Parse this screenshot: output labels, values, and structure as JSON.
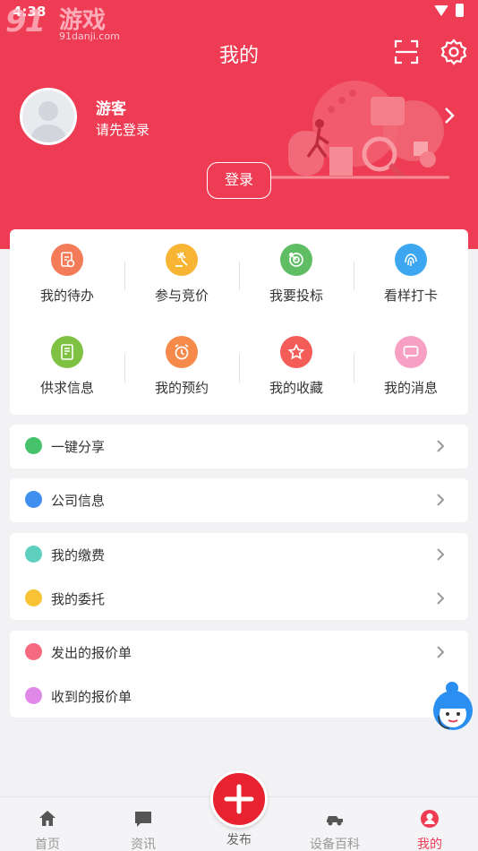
{
  "status": {
    "time": "4:38"
  },
  "watermark": {
    "logo": "91",
    "name": "游戏",
    "url": "91danji.com"
  },
  "header": {
    "title": "我的"
  },
  "profile": {
    "name": "游客",
    "hint": "请先登录",
    "login_label": "登录"
  },
  "grid": [
    {
      "label": "我的待办",
      "icon": "todo-icon",
      "color": "#f47b57"
    },
    {
      "label": "参与竞价",
      "icon": "auction-hammer-icon",
      "color": "#f7b533"
    },
    {
      "label": "我要投标",
      "icon": "target-icon",
      "color": "#5fbe63"
    },
    {
      "label": "看样打卡",
      "icon": "fingerprint-icon",
      "color": "#3ca6f0"
    },
    {
      "label": "供求信息",
      "icon": "document-icon",
      "color": "#7fc243"
    },
    {
      "label": "我的预约",
      "icon": "alarm-clock-icon",
      "color": "#f58a4a"
    },
    {
      "label": "我的收藏",
      "icon": "star-icon",
      "color": "#f45c58"
    },
    {
      "label": "我的消息",
      "icon": "message-icon",
      "color": "#f7a0c3"
    }
  ],
  "menu": {
    "share": {
      "label": "一键分享",
      "color": "#46c36a"
    },
    "company": {
      "label": "公司信息",
      "color": "#3f8ff0"
    },
    "fees": {
      "label": "我的缴费",
      "color": "#5fd0c0"
    },
    "entrust": {
      "label": "我的委托",
      "color": "#f7c234"
    },
    "quotes_sent": {
      "label": "发出的报价单",
      "color": "#f56a7f"
    },
    "quotes_received": {
      "label": "收到的报价单",
      "color": "#e088e8"
    }
  },
  "tabs": [
    {
      "label": "首页",
      "icon": "home-icon"
    },
    {
      "label": "资讯",
      "icon": "news-icon"
    },
    {
      "label": "发布",
      "icon": "plus-icon"
    },
    {
      "label": "设备百科",
      "icon": "vehicle-icon"
    },
    {
      "label": "我的",
      "icon": "user-icon"
    }
  ],
  "colors": {
    "brand": "#ee3c54",
    "publish": "#e8232f"
  }
}
